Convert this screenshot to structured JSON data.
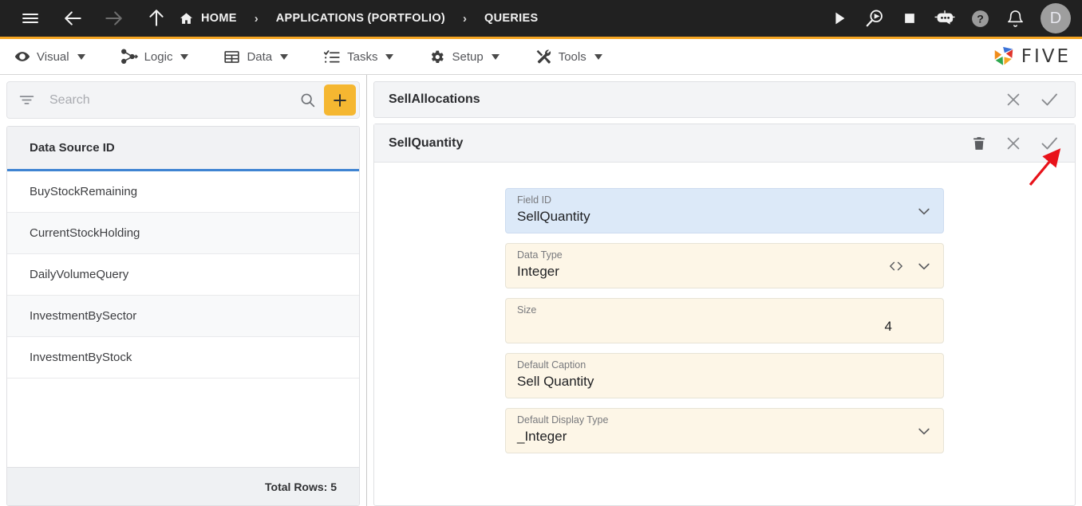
{
  "topbar": {
    "menu_icon": "hamburger-icon",
    "back_icon": "arrow-left-icon",
    "forward_icon": "arrow-right-icon",
    "up_icon": "arrow-up-icon",
    "home_label": "HOME",
    "sep": "›",
    "breadcrumb": [
      "APPLICATIONS (PORTFOLIO)",
      "QUERIES"
    ],
    "actions": [
      "run-icon",
      "debug-icon",
      "stop-icon",
      "chatbot-icon",
      "help-icon",
      "notifications-icon"
    ],
    "avatar_initial": "D",
    "bg_color": "#212121"
  },
  "menubar": {
    "accent_color": "#f5a623",
    "items": [
      {
        "label": "Visual",
        "icon": "eye-icon"
      },
      {
        "label": "Logic",
        "icon": "node-graph-icon"
      },
      {
        "label": "Data",
        "icon": "table-icon"
      },
      {
        "label": "Tasks",
        "icon": "checklist-icon"
      },
      {
        "label": "Setup",
        "icon": "gear-icon"
      },
      {
        "label": "Tools",
        "icon": "tools-icon"
      }
    ],
    "logo_text": "FIVE"
  },
  "sidebar": {
    "search": {
      "placeholder": "Search",
      "value": "",
      "filter_icon": "filter-icon",
      "search_icon": "search-icon",
      "add_label": "+"
    },
    "grid": {
      "header": "Data Source ID",
      "header_underline_color": "#3f84d2",
      "rows": [
        "BuyStockRemaining",
        "CurrentStockHolding",
        "DailyVolumeQuery",
        "InvestmentBySector",
        "InvestmentByStock"
      ],
      "footer": "Total Rows: 5"
    }
  },
  "detail": {
    "outer": {
      "title": "SellAllocations",
      "close_icon": "close-icon",
      "confirm_icon": "check-icon"
    },
    "inner": {
      "title": "SellQuantity",
      "delete_icon": "trash-icon",
      "close_icon": "close-icon",
      "confirm_icon": "check-icon"
    },
    "fields": [
      {
        "label": "Field ID",
        "value": "SellQuantity",
        "state": "focused",
        "adornments": [
          "chevron-down-icon"
        ],
        "align": "left",
        "bg": "#dce9f8"
      },
      {
        "label": "Data Type",
        "value": "Integer",
        "state": "normal",
        "adornments": [
          "code-brackets-icon",
          "chevron-down-icon"
        ],
        "align": "left",
        "bg": "#fdf6e7"
      },
      {
        "label": "Size",
        "value": "4",
        "state": "normal",
        "adornments": [],
        "align": "right",
        "bg": "#fdf6e7"
      },
      {
        "label": "Default Caption",
        "value": "Sell Quantity",
        "state": "normal",
        "adornments": [],
        "align": "left",
        "bg": "#fdf6e7"
      },
      {
        "label": "Default Display Type",
        "value": "_Integer",
        "state": "normal",
        "adornments": [
          "chevron-down-icon"
        ],
        "align": "left",
        "bg": "#fdf6e7"
      }
    ]
  },
  "annotation": {
    "arrow_color": "#e8121a",
    "points_to": "inner-confirm-check-icon"
  }
}
